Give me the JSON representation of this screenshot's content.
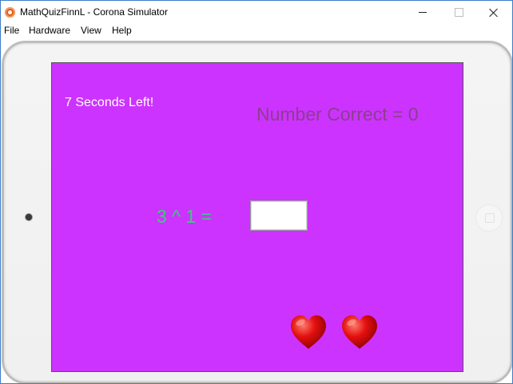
{
  "window": {
    "title": "MathQuizFinnL - Corona Simulator"
  },
  "menu": {
    "items": [
      "File",
      "Hardware",
      "View",
      "Help"
    ]
  },
  "game": {
    "timer_text": "7 Seconds Left!",
    "score_text": "Number Correct = 0",
    "question_text": "3 ^ 1 =",
    "answer_value": "",
    "lives": 2
  },
  "colors": {
    "screen_background": "#cc33ff",
    "timer_text": "#ffffff",
    "score_text": "#8c3e8e",
    "question_text": "#3ccc79",
    "heart": "#e3100f"
  },
  "icons": {
    "app": "corona-simulator-icon",
    "minimize": "minimize-icon",
    "maximize": "maximize-icon",
    "close": "close-icon",
    "life": "heart-icon"
  }
}
